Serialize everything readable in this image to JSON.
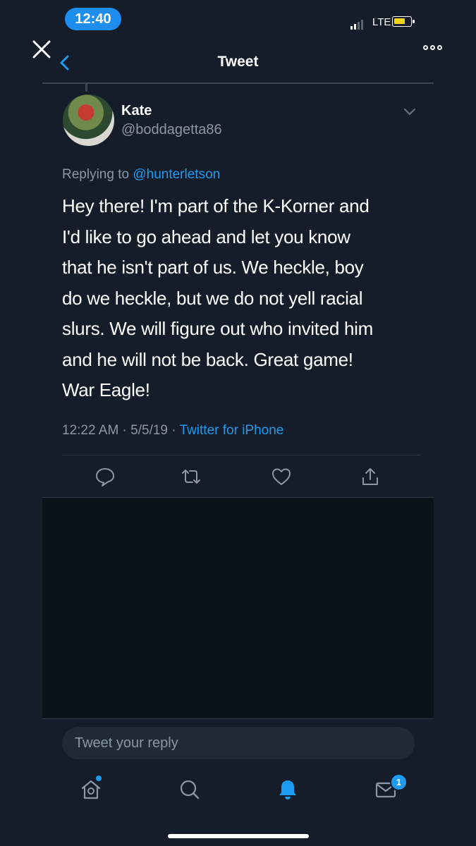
{
  "status_bar": {
    "time": "12:40",
    "network": "LTE"
  },
  "header": {
    "title": "Tweet"
  },
  "tweet": {
    "author_name": "Kate",
    "author_handle": "@boddagetta86",
    "replying_prefix": "Replying to",
    "replying_to": "@hunterletson",
    "text": "Hey there! I'm part of the K-Korner and\nI'd like to go ahead and let you know\nthat he isn't part of us. We heckle, boy\ndo we heckle, but we do not yell racial\nslurs. We will figure out who invited him\nand he will not be back. Great game!\nWar Eagle!",
    "timestamp": "12:22 AM · 5/5/19 · ",
    "source": "Twitter for iPhone"
  },
  "reply": {
    "placeholder": "Tweet your reply"
  },
  "tab_bar": {
    "messages_badge": "1"
  },
  "colors": {
    "accent": "#1d9bf0",
    "background": "#151d2a",
    "secondary_text": "#8a97a8"
  }
}
